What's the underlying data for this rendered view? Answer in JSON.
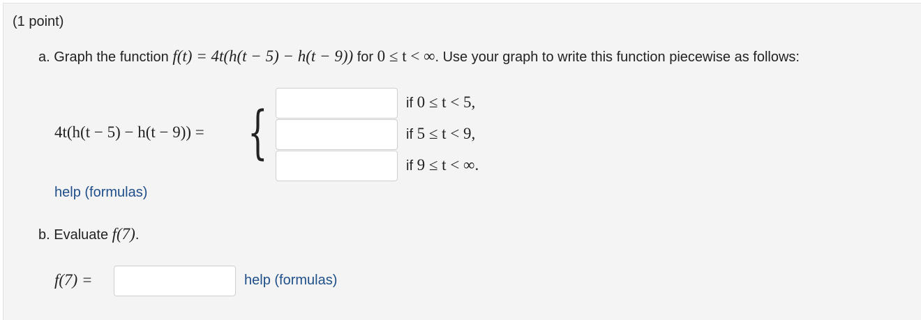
{
  "points": "(1 point)",
  "part_a": {
    "prefix": "a. Graph the function ",
    "function_expr": "f(t) = 4t(h(t − 5) − h(t − 9))",
    "for_word": " for ",
    "domain": "0 ≤ t < ∞",
    "suffix": ". Use your graph to write this function piecewise as follows:",
    "lhs": "4t(h(t − 5) − h(t − 9)) =",
    "brace": "{",
    "pieces": [
      {
        "if_word": "if ",
        "condition": "0 ≤ t < 5,",
        "value": ""
      },
      {
        "if_word": "if ",
        "condition": "5 ≤ t < 9,",
        "value": ""
      },
      {
        "if_word": "if ",
        "condition": "9 ≤ t < ∞.",
        "value": ""
      }
    ],
    "help": "help (formulas)"
  },
  "part_b": {
    "prefix": "b. Evaluate ",
    "expr": "f(7)",
    "period": ".",
    "lhs": "f(7) =",
    "value": "",
    "help": "help (formulas)"
  }
}
